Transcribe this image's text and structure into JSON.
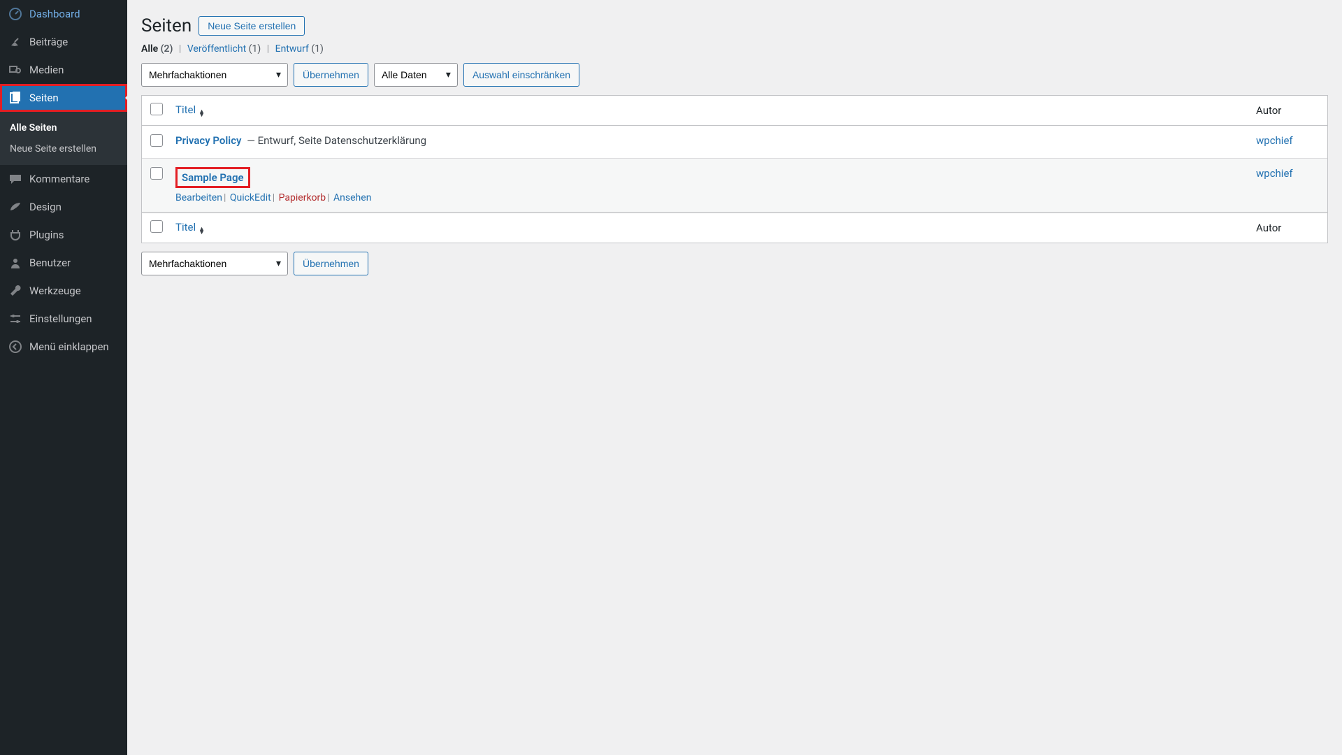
{
  "sidebar": {
    "items": [
      {
        "label": "Dashboard"
      },
      {
        "label": "Beiträge"
      },
      {
        "label": "Medien"
      },
      {
        "label": "Seiten"
      },
      {
        "label": "Kommentare"
      },
      {
        "label": "Design"
      },
      {
        "label": "Plugins"
      },
      {
        "label": "Benutzer"
      },
      {
        "label": "Werkzeuge"
      },
      {
        "label": "Einstellungen"
      },
      {
        "label": "Menü einklappen"
      }
    ],
    "submenu": [
      {
        "label": "Alle Seiten"
      },
      {
        "label": "Neue Seite erstellen"
      }
    ]
  },
  "header": {
    "title": "Seiten",
    "newButton": "Neue Seite erstellen"
  },
  "tabs": {
    "all": {
      "label": "Alle",
      "count": "(2)"
    },
    "published": {
      "label": "Veröffentlicht",
      "count": "(1)"
    },
    "draft": {
      "label": "Entwurf",
      "count": "(1)"
    }
  },
  "controls": {
    "bulk": "Mehrfachaktionen",
    "apply": "Übernehmen",
    "dateFilter": "Alle Daten",
    "filter": "Auswahl einschränken"
  },
  "table": {
    "colTitle": "Titel",
    "colAuthor": "Autor",
    "rows": [
      {
        "title": "Privacy Policy",
        "suffix": " — Entwurf, Seite Datenschutzerklärung",
        "author": "wpchief",
        "highlighted": false
      },
      {
        "title": "Sample Page",
        "suffix": "",
        "author": "wpchief",
        "highlighted": true,
        "actions": {
          "edit": "Bearbeiten",
          "quick": "QuickEdit",
          "trash": "Papierkorb",
          "view": "Ansehen"
        }
      }
    ]
  }
}
